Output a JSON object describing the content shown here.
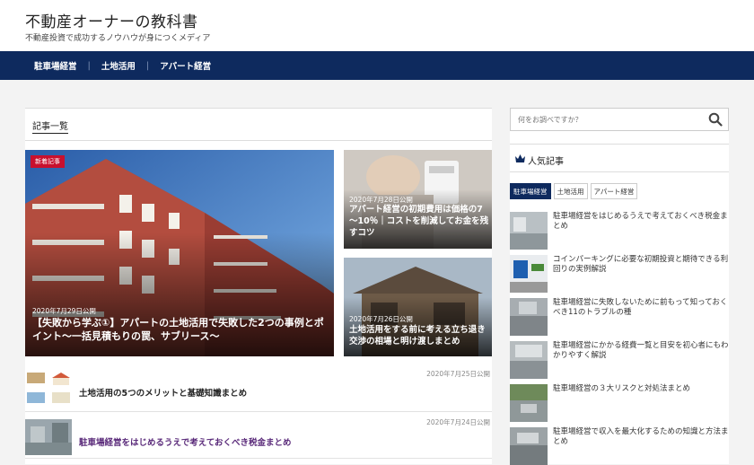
{
  "site": {
    "title": "不動産オーナーの教科書",
    "tagline": "不動産投資で成功するノウハウが身につくメディア"
  },
  "nav": [
    "駐車場経営",
    "土地活用",
    "アパート経営"
  ],
  "main": {
    "section_title": "記事一覧",
    "featured": {
      "badge": "新着記事",
      "date": "2020年7月29日公開",
      "title": "【失敗から学ぶ①】アパートの土地活用で失敗した2つの事例とポイント～一括見積もりの罠、サブリース～"
    },
    "side_cards": [
      {
        "date": "2020年7月28日公開",
        "title": "アパート経営の初期費用は価格の7～10％｜コストを削減してお金を残すコツ"
      },
      {
        "date": "2020年7月26日公開",
        "title": "土地活用をする前に考える立ち退き交渉の相場と明け渡しまとめ"
      }
    ],
    "list": [
      {
        "date": "2020年7月25日公開",
        "title": "土地活用の5つのメリットと基礎知識まとめ"
      },
      {
        "date": "2020年7月24日公開",
        "title": "駐車場経営をはじめるうえで考えておくべき税金まとめ"
      }
    ]
  },
  "sidebar": {
    "search_placeholder": "何をお調べですか？",
    "popular_title": "人気記事",
    "tabs": [
      "駐車場経営",
      "土地活用",
      "アパート経営"
    ],
    "items": [
      "駐車場経営をはじめるうえで考えておくべき税金まとめ",
      "コインパーキングに必要な初期投資と期待できる利回りの実例解説",
      "駐車場経営に失敗しないために前もって知っておくべき11のトラブルの種",
      "駐車場経営にかかる経費一覧と目安を初心者にもわかりやすく解説",
      "駐車場経営の３大リスクと対処法まとめ",
      "駐車場経営で収入を最大化するための知識と方法まとめ"
    ]
  },
  "colors": {
    "nav": "#0e2a5e",
    "badge": "#c8102e",
    "visited_link": "#5a2a7a"
  }
}
